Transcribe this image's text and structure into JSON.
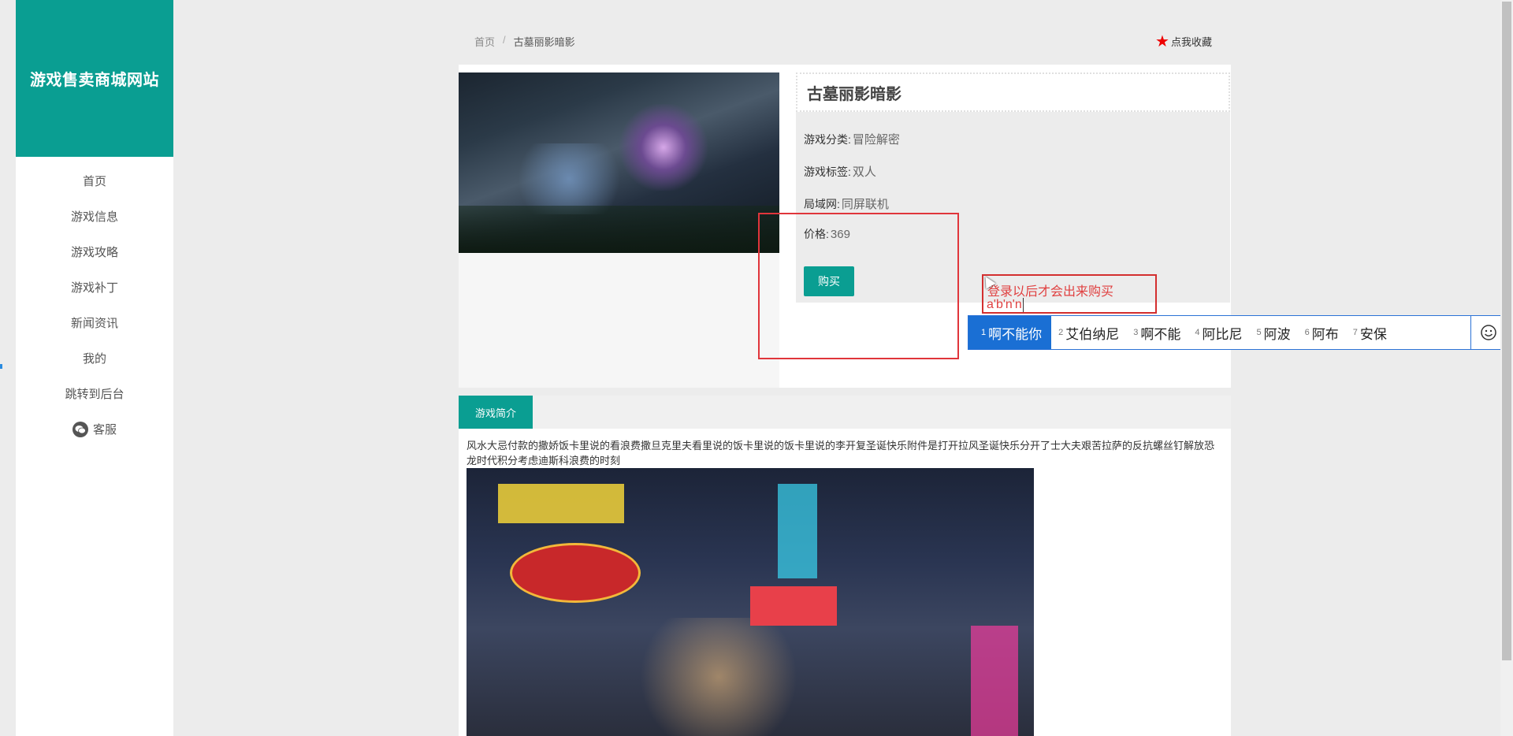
{
  "site": {
    "brand": "游戏售卖商城网站"
  },
  "nav": {
    "items": [
      {
        "label": "首页"
      },
      {
        "label": "游戏信息"
      },
      {
        "label": "游戏攻略"
      },
      {
        "label": "游戏补丁"
      },
      {
        "label": "新闻资讯"
      },
      {
        "label": "我的"
      },
      {
        "label": "跳转到后台"
      }
    ],
    "service_label": "客服"
  },
  "breadcrumb": {
    "home": "首页",
    "separator": "/",
    "current": "古墓丽影暗影"
  },
  "favorite": {
    "label": "点我收藏",
    "icon": "star-icon",
    "color": "#e00000"
  },
  "game": {
    "title": "古墓丽影暗影",
    "category_label": "游戏分类:",
    "category": "冒险解密",
    "tag_label": "游戏标签:",
    "tag": "双人",
    "lan_label": "局域网:",
    "lan": "同屏联机",
    "price_label": "价格:",
    "price": "369",
    "buy_label": "购买"
  },
  "annotation": {
    "note": "登录以后才会出来购买",
    "typed_text": "a'b'n'n"
  },
  "ime": {
    "candidates": [
      {
        "num": "1",
        "text": "啊不能你"
      },
      {
        "num": "2",
        "text": "艾伯纳尼"
      },
      {
        "num": "3",
        "text": "啊不能"
      },
      {
        "num": "4",
        "text": "阿比尼"
      },
      {
        "num": "5",
        "text": "阿波"
      },
      {
        "num": "6",
        "text": "阿布"
      },
      {
        "num": "7",
        "text": "安保"
      }
    ],
    "emoji_icon": "smiley-icon"
  },
  "intro": {
    "tab_label": "游戏简介",
    "description": "风水大忌付款的撒娇饭卡里说的看浪费撒旦克里夫看里说的饭卡里说的饭卡里说的李开复圣诞快乐附件是打开拉风圣诞快乐分开了士大夫艰苦拉萨的反抗螺丝钉解放恐龙时代积分考虑迪斯科浪费的时刻"
  },
  "colors": {
    "accent": "#0a9e92",
    "annotation_red": "#e0353b",
    "ime_blue": "#1a6fd4"
  }
}
